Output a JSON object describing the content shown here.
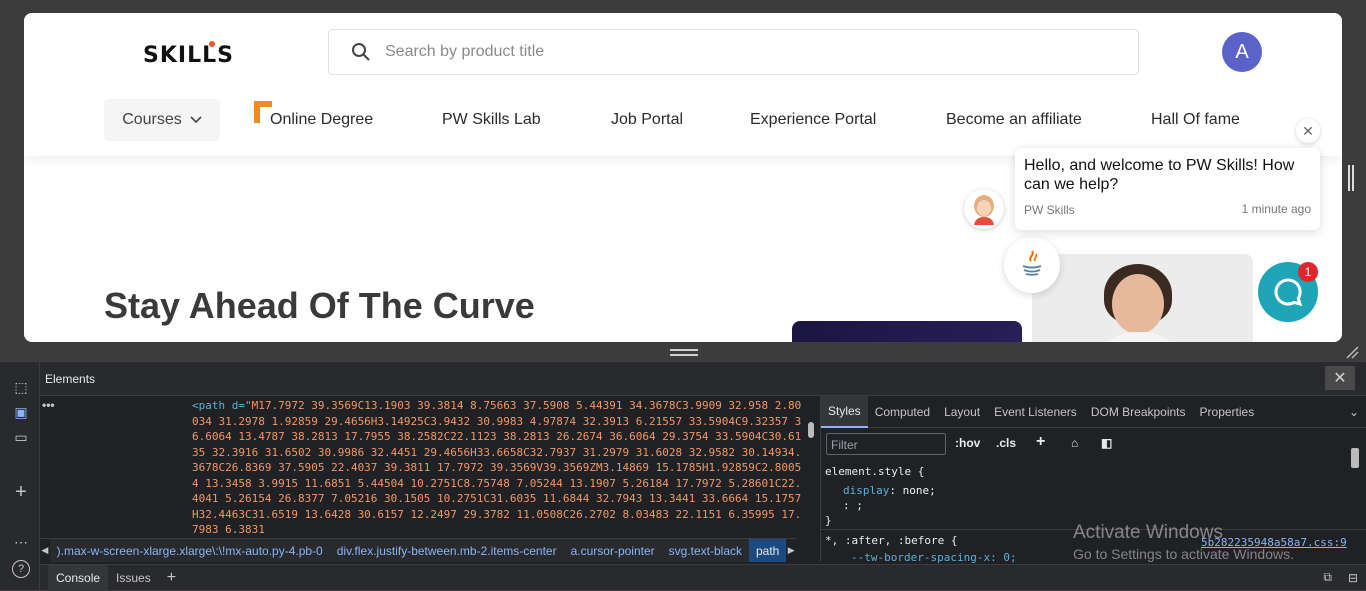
{
  "site": {
    "logo": "SKILLS",
    "search_placeholder": "Search by product title",
    "avatar_initial": "A",
    "nav": {
      "courses": "Courses",
      "online_degree": "Online Degree",
      "skills_lab": "PW Skills Lab",
      "job_portal": "Job Portal",
      "experience_portal": "Experience Portal",
      "affiliate": "Become an affiliate",
      "hall_of_fame": "Hall Of fame"
    },
    "hero_title": "Stay Ahead Of The Curve"
  },
  "chat": {
    "message": "Hello, and welcome to PW Skills! How can we help?",
    "sender": "PW Skills",
    "time": "1 minute ago",
    "unread_count": "1",
    "close_glyph": "✕"
  },
  "devtools": {
    "panel_title": "Elements",
    "code_tag": "<path d=\"",
    "code_path": "M17.7972 39.3569C13.1903 39.3814 8.75663 37.5908 5.44391 34.3678C3.9909 32.958 2.80034 31.2978 1.92859 29.4656H3.14925C3.9432 30.9983 4.97874 32.3913 6.21557 33.5904C9.32357 36.6064 13.4787 38.2813 17.7955 38.2582C22.1123 38.2813 26.2674 36.6064 29.3754 33.5904C30.6135 32.3916 31.6502 30.9986 32.4451 29.4656H33.6658C32.7937 31.2979 31.6028 32.9582 30.14934.3678C26.8369 37.5905 22.4037 39.3811 17.7972 39.3569V39.3569ZM3.14869 15.1785H1.92859C2.80054 13.3458 3.9915 11.6851 5.44504 10.2751C8.75748 7.05244 13.1907 5.26184 17.7972 5.28601C22.4041 5.26154 26.8377 7.05216 30.1505 10.2751C31.6035 11.6844 32.7943 13.3441 33.6664 15.1757H32.4463C31.6519 13.6428 30.6157 12.2497 29.3782 11.0508C26.2702 8.03483 22.1151 6.35995 17.7983 6.3831",
    "breadcrumbs": [
      ").max-w-screen-xlarge.xlarge\\:\\!mx-auto.py-4.pb-0",
      "div.flex.justify-between.mb-2.items-center",
      "a.cursor-pointer",
      "svg.text-black",
      "path"
    ],
    "styles_tabs": [
      "Styles",
      "Computed",
      "Layout",
      "Event Listeners",
      "DOM Breakpoints",
      "Properties"
    ],
    "filter_placeholder": "Filter",
    "hov": ":hov",
    "cls": ".cls",
    "element_style": "element.style {",
    "display_prop": "display",
    "display_val": "none;",
    "semicolon": ": ;",
    "close_brace": "}",
    "after_before": "*, :after, :before {",
    "tw_prop": "--tw-border-spacing-x: 0;",
    "css_link": "5b282235948a58a7.css:9",
    "drawer_tabs": [
      "Console",
      "Issues"
    ]
  },
  "windows": {
    "activate_title": "Activate Windows",
    "activate_sub": "Go to Settings to activate Windows."
  }
}
